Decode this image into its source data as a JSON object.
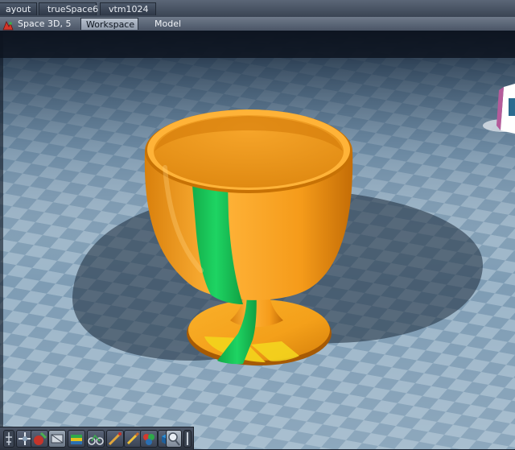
{
  "layout_tabs": [
    "ayout",
    "trueSpace6",
    "vtm1024"
  ],
  "viewport_bar": {
    "title": "Space 3D, 5",
    "tabs": [
      "Workspace",
      "Model"
    ],
    "active_tab": "Workspace"
  },
  "colors": {
    "floor": "#7c9bb3",
    "cup": "#f5a21d",
    "stripe": "#18c456",
    "foot_highlight": "#f2d21a"
  },
  "toolbar_icons": [
    "move-object-icon",
    "paint-object-icon",
    "material-icon",
    "layers-icon",
    "bike-icon",
    "brush-icon",
    "pencil-icon",
    "spheres-icon",
    "cube-icon",
    "zoom-icon",
    "slider-icon"
  ]
}
